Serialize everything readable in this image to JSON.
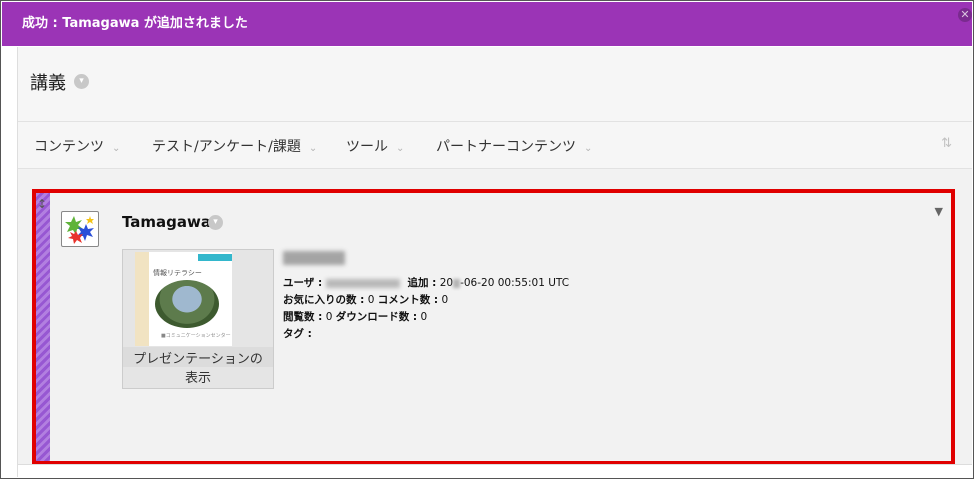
{
  "banner": {
    "message": "成功 : Tamagawa が追加されました"
  },
  "page": {
    "title": "講義"
  },
  "menu": {
    "items": [
      {
        "label": "コンテンツ"
      },
      {
        "label": "テスト/アンケート/課題"
      },
      {
        "label": "ツール"
      },
      {
        "label": "パートナーコンテンツ"
      }
    ]
  },
  "item": {
    "title": "Tamagawa",
    "thumb": {
      "slide_title": "情報リテラシー",
      "slide_footer": "■コミュニケーションセンター",
      "label_line1": "プレゼンテーションの",
      "label_line2": "表示"
    },
    "meta": {
      "user_label": "ユーザ :",
      "added_label": "追加 :",
      "added_prefix": "20",
      "added_suffix": "-06-20 00:55:01 UTC",
      "favorites_label": "お気に入りの数 :",
      "favorites_value": "0",
      "comments_label": "コメント数 :",
      "comments_value": "0",
      "views_label": "閲覧数 :",
      "views_value": "0",
      "downloads_label": "ダウンロード数 :",
      "downloads_value": "0",
      "tags_label": "タグ :"
    }
  },
  "icons": {
    "banner_close": "close-icon",
    "sort": "sort-arrows-icon",
    "drag": "drag-handle-icon",
    "item_menu": "triangle-down-icon"
  },
  "colors": {
    "banner": "#9b34b6",
    "highlight": "#e00000",
    "stripe": "#b27fe0"
  }
}
